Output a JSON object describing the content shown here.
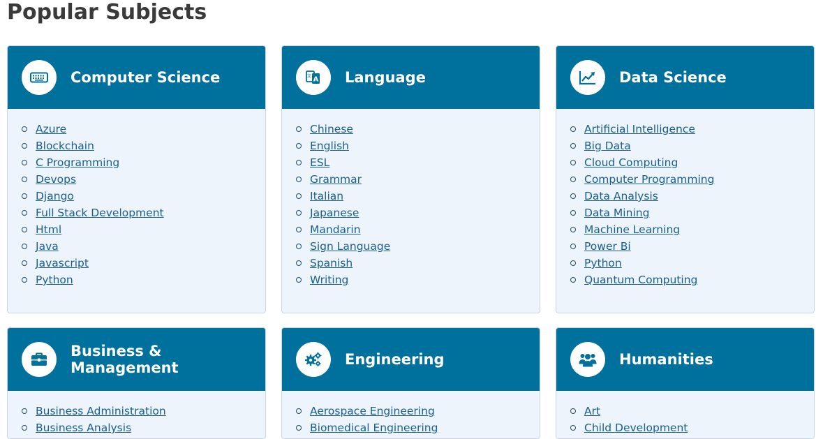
{
  "page": {
    "title": "Popular Subjects"
  },
  "colors": {
    "header_bg": "#00709c",
    "card_bg": "#eef4fc",
    "link": "#175e93"
  },
  "cards": [
    {
      "title": "Computer Science",
      "icon": "keyboard-icon",
      "items": [
        "Azure",
        "Blockchain",
        "C Programming",
        "Devops",
        "Django",
        "Full Stack Development",
        "Html",
        "Java",
        "Javascript",
        "Python"
      ]
    },
    {
      "title": "Language",
      "icon": "translate-icon",
      "items": [
        "Chinese",
        "English",
        "ESL",
        "Grammar",
        "Italian",
        "Japanese",
        "Mandarin",
        "Sign Language",
        "Spanish",
        "Writing"
      ]
    },
    {
      "title": "Data Science",
      "icon": "chart-line-icon",
      "items": [
        "Artificial Intelligence",
        "Big Data",
        "Cloud Computing",
        "Computer Programming",
        "Data Analysis",
        "Data Mining",
        "Machine Learning",
        "Power Bi",
        "Python",
        "Quantum Computing"
      ]
    },
    {
      "title": "Business & Management",
      "icon": "briefcase-icon",
      "items": [
        "Business Administration",
        "Business Analysis"
      ]
    },
    {
      "title": "Engineering",
      "icon": "gears-icon",
      "items": [
        "Aerospace Engineering",
        "Biomedical Engineering"
      ]
    },
    {
      "title": "Humanities",
      "icon": "users-icon",
      "items": [
        "Art",
        "Child Development"
      ]
    }
  ]
}
